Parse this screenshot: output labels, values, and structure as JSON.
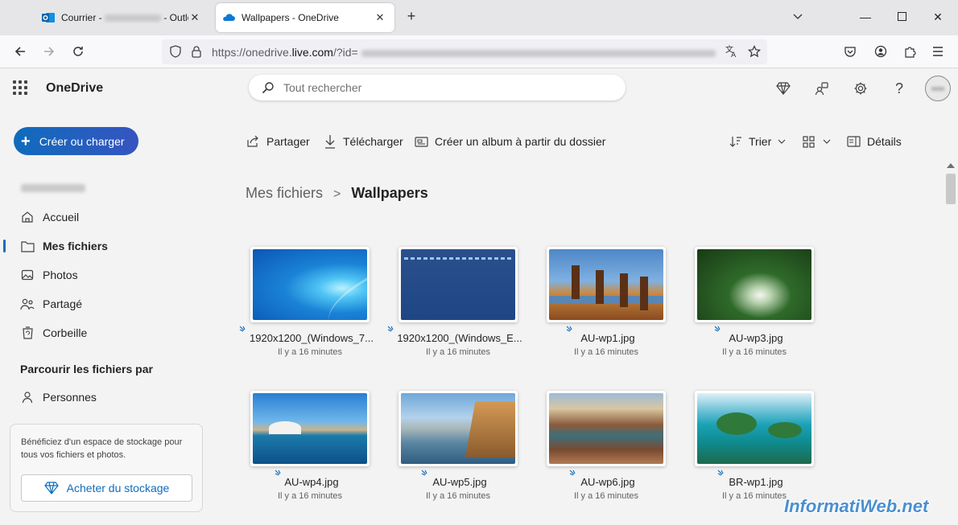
{
  "browser": {
    "tabs": [
      {
        "title_prefix": "Courrier - ",
        "title_suffix": " - Outloo",
        "icon": "outlook-icon"
      },
      {
        "title": "Wallpapers - OneDrive",
        "icon": "onedrive-icon"
      }
    ],
    "new_tab_label": "+",
    "url_prefix": "https://onedrive.",
    "url_domain": "live.com",
    "url_suffix": "/?id="
  },
  "app": {
    "name": "OneDrive",
    "search_placeholder": "Tout rechercher"
  },
  "sidebar": {
    "create_label": "Créer ou charger",
    "nav": [
      {
        "label": "Accueil",
        "icon": "home-icon"
      },
      {
        "label": "Mes fichiers",
        "icon": "folder-icon",
        "active": true
      },
      {
        "label": "Photos",
        "icon": "photos-icon"
      },
      {
        "label": "Partagé",
        "icon": "shared-icon"
      },
      {
        "label": "Corbeille",
        "icon": "recycle-bin-icon"
      }
    ],
    "browse_header": "Parcourir les fichiers par",
    "browse_items": [
      {
        "label": "Personnes",
        "icon": "person-icon"
      }
    ],
    "promo_text": "Bénéficiez d'un espace de stockage pour tous vos fichiers et photos.",
    "buy_label": "Acheter du stockage"
  },
  "commands": {
    "share": "Partager",
    "download": "Télécharger",
    "album": "Créer un album à partir du dossier",
    "sort": "Trier",
    "details": "Détails"
  },
  "breadcrumb": {
    "root": "Mes fichiers",
    "separator": ">",
    "current": "Wallpapers"
  },
  "files": [
    {
      "name": "1920x1200_(Windows_7...",
      "date": "Il y a 16 minutes"
    },
    {
      "name": "1920x1200_(Windows_E...",
      "date": "Il y a 16 minutes"
    },
    {
      "name": "AU-wp1.jpg",
      "date": "Il y a 16 minutes"
    },
    {
      "name": "AU-wp3.jpg",
      "date": "Il y a 16 minutes"
    },
    {
      "name": "AU-wp4.jpg",
      "date": "Il y a 16 minutes"
    },
    {
      "name": "AU-wp5.jpg",
      "date": "Il y a 16 minutes"
    },
    {
      "name": "AU-wp6.jpg",
      "date": "Il y a 16 minutes"
    },
    {
      "name": "BR-wp1.jpg",
      "date": "Il y a 16 minutes"
    }
  ],
  "watermark": "InformatiWeb.net",
  "colors": {
    "accent": "#0f6cbd",
    "accent2": "#3654c0"
  }
}
